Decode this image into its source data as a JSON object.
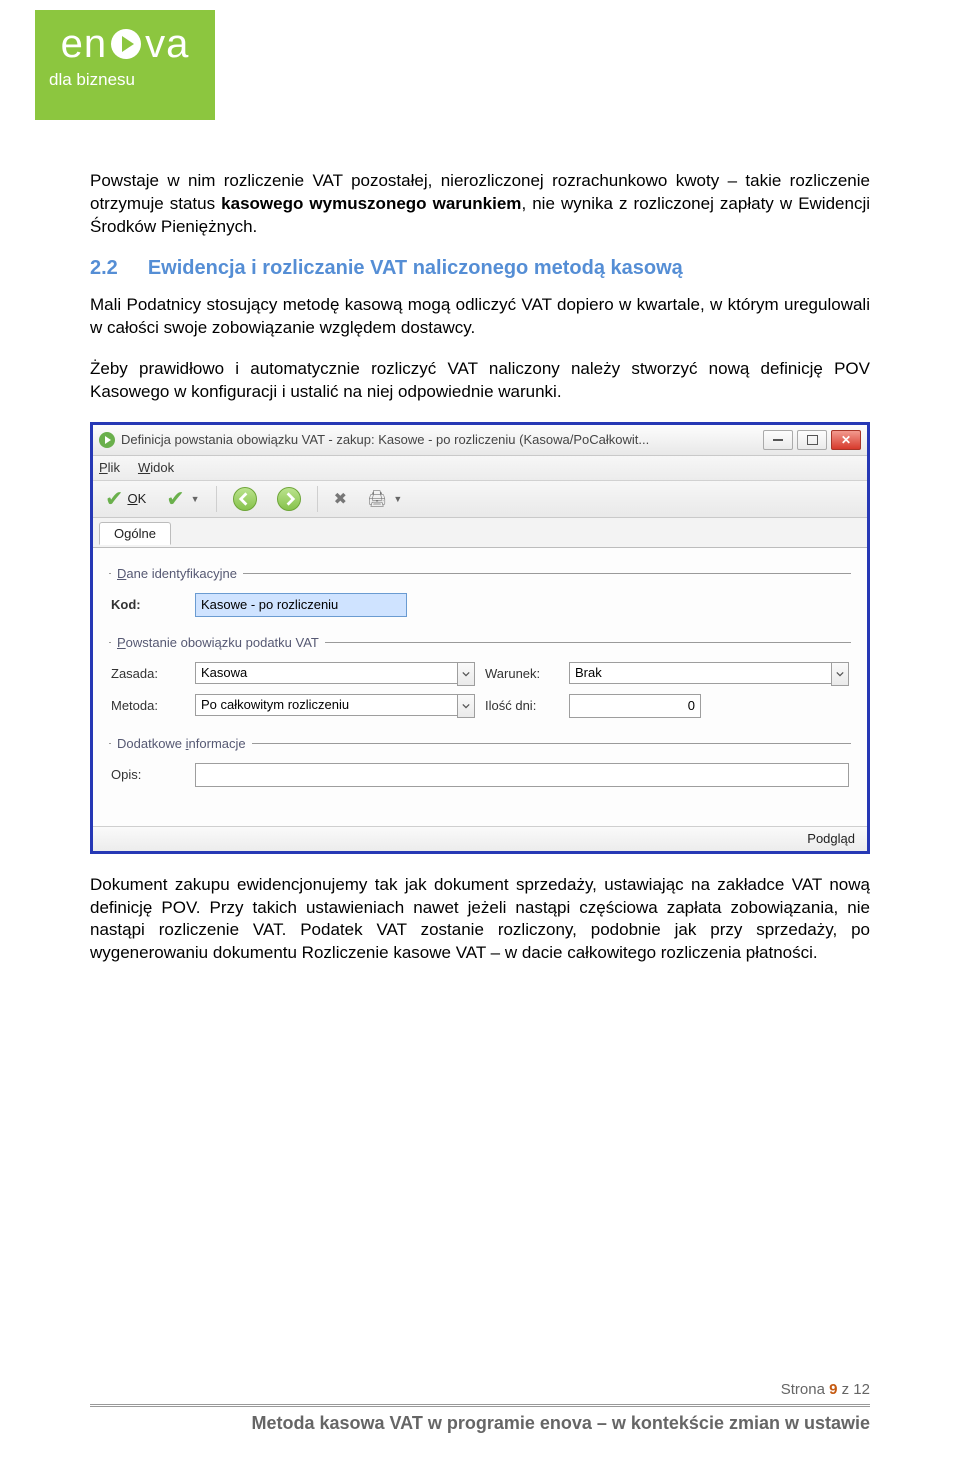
{
  "logo": {
    "brand_prefix": "en",
    "brand_suffix": "va",
    "tagline": "dla biznesu"
  },
  "para1_a": "Powstaje w nim rozliczenie VAT pozostałej, nierozliczonej rozrachunkowo kwoty – takie rozliczenie otrzymuje status ",
  "para1_b": "kasowego wymuszonego warunkiem",
  "para1_c": ", nie wynika z rozliczonej zapłaty w Ewidencji Środków Pieniężnych.",
  "h2_num": "2.2",
  "h2_title": "Ewidencja i rozliczanie VAT naliczonego metodą kasową",
  "para2": "Mali Podatnicy stosujący metodę kasową mogą odliczyć VAT dopiero w kwartale, w którym uregulowali w całości swoje zobowiązanie względem dostawcy.",
  "para3": "Żeby prawidłowo i automatycznie rozliczyć VAT naliczony należy stworzyć nową definicję POV Kasowego w konfiguracji i ustalić na niej odpowiednie warunki.",
  "win": {
    "title": "Definicja powstania obowiązku VAT - zakup: Kasowe - po rozliczeniu (Kasowa/PoCałkowit...",
    "menu_file": "Plik",
    "menu_view": "Widok",
    "ok_label": "OK",
    "tab_general": "Ogólne",
    "grp_id": "Dane identyfikacyjne",
    "lbl_kod": "Kod:",
    "val_kod": "Kasowe - po rozliczeniu",
    "grp_vat": "Powstanie obowiązku podatku VAT",
    "lbl_zasada": "Zasada:",
    "val_zasada": "Kasowa",
    "lbl_warunek": "Warunek:",
    "val_warunek": "Brak",
    "lbl_metoda": "Metoda:",
    "val_metoda": "Po całkowitym rozliczeniu",
    "lbl_iloscdni": "Ilość dni:",
    "val_iloscdni": "0",
    "grp_extra": "Dodatkowe informacje",
    "lbl_opis": "Opis:",
    "val_opis": "",
    "status_label": "Podgląd"
  },
  "para4": "Dokument zakupu ewidencjonujemy tak jak dokument sprzedaży, ustawiając na zakładce VAT nową definicję POV. Przy takich ustawieniach nawet jeżeli nastąpi częściowa zapłata zobowiązania, nie nastąpi rozliczenie VAT. Podatek VAT zostanie rozliczony, podobnie jak przy sprzedaży, po wygenerowaniu dokumentu Rozliczenie kasowe VAT – w dacie całkowitego rozliczenia płatności.",
  "footer": {
    "page_label": "Strona ",
    "page_num": "9",
    "page_of": " z 12",
    "doc_title": "Metoda kasowa VAT w programie enova – w kontekście zmian w ustawie"
  }
}
